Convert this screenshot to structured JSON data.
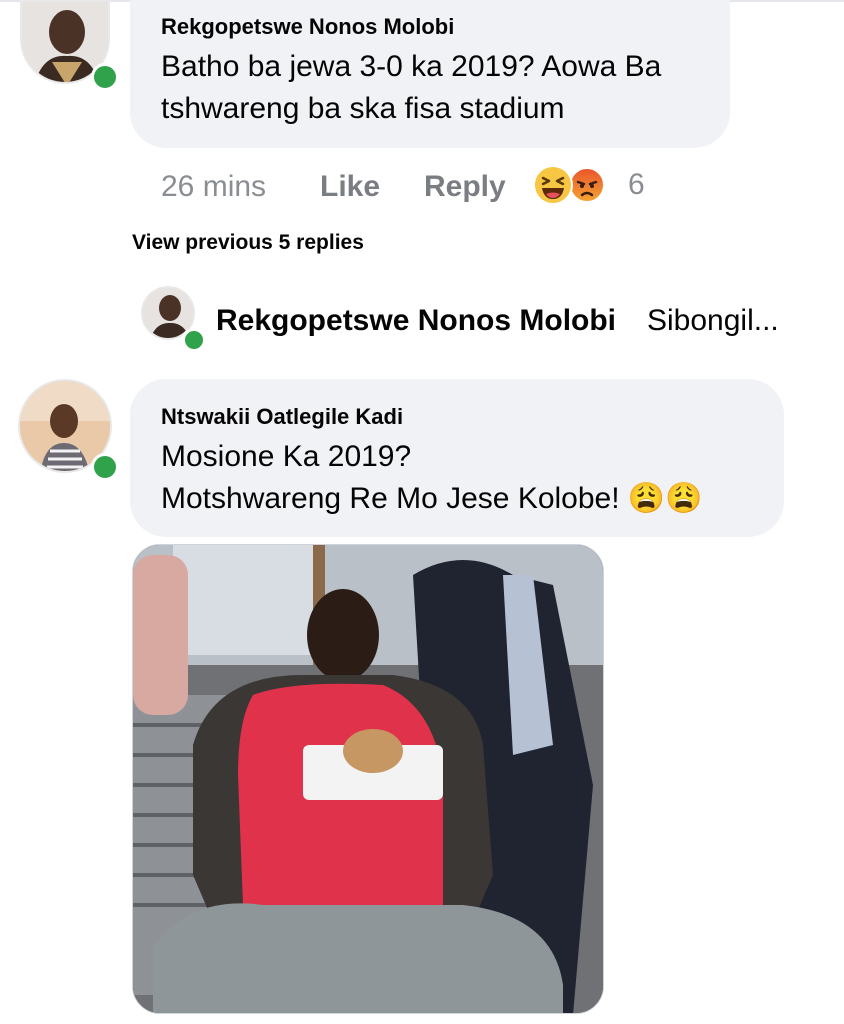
{
  "comments": [
    {
      "author": "Rekgopetswe Nonos Molobi",
      "lines": [
        "Batho ba jewa 3-0 ka 2019? Aowa Ba",
        "tshwareng ba ska fisa stadium"
      ],
      "time": "26 mins",
      "like_label": "Like",
      "reply_label": "Reply",
      "reaction_icons": [
        "laughing-emoji-icon",
        "angry-emoji-icon"
      ],
      "reaction_count": "6",
      "online": true
    },
    {
      "author": "Ntswakii Oatlegile Kadi",
      "lines": [
        "Mosione Ka 2019?",
        "Motshwareng Re Mo Jese Kolobe! 😩😩"
      ],
      "online": true
    }
  ],
  "view_previous_replies": "View previous 5 replies",
  "reply_preview": {
    "author": "Rekgopetswe Nonos Molobi",
    "snippet": "Sibongil..."
  },
  "colors": {
    "bubble": "#f0f2f5",
    "online": "#31a24c",
    "meta_text": "#8a8d91"
  }
}
